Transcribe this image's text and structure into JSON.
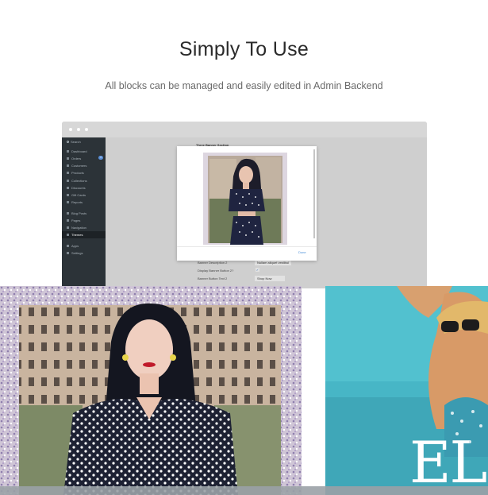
{
  "header": {
    "title": "Simply To Use",
    "subtitle": "All blocks can be managed and easily edited in Admin Backend"
  },
  "admin": {
    "sidebar": {
      "search": "Search",
      "items": [
        {
          "label": "Dashboard"
        },
        {
          "label": "Orders",
          "badge": "3"
        },
        {
          "label": "Customers"
        },
        {
          "label": "Products"
        },
        {
          "label": "Collections"
        },
        {
          "label": "Discounts"
        },
        {
          "label": "Gift Cards"
        },
        {
          "label": "Reports"
        },
        {
          "label": "Blog Posts"
        },
        {
          "label": "Pages"
        },
        {
          "label": "Navigation"
        },
        {
          "label": "Themes",
          "active": true
        },
        {
          "label": "Apps"
        },
        {
          "label": "Settings"
        }
      ]
    },
    "section_title": "Three Banner Section",
    "form": [
      {
        "label": "Banner Description 2",
        "value": "Nullam aliquet vestibul"
      },
      {
        "label": "Display Banner Button 2?",
        "value": ""
      },
      {
        "label": "Banner Button Text 2",
        "value": "Shop Now"
      }
    ],
    "modal": {
      "done_label": "Done"
    }
  },
  "photo_right": {
    "logo_text": "ELI"
  },
  "colors": {
    "sidebar_bg": "#2c3338",
    "accent": "#4a90d9",
    "window_bg": "#c9c9c9"
  }
}
